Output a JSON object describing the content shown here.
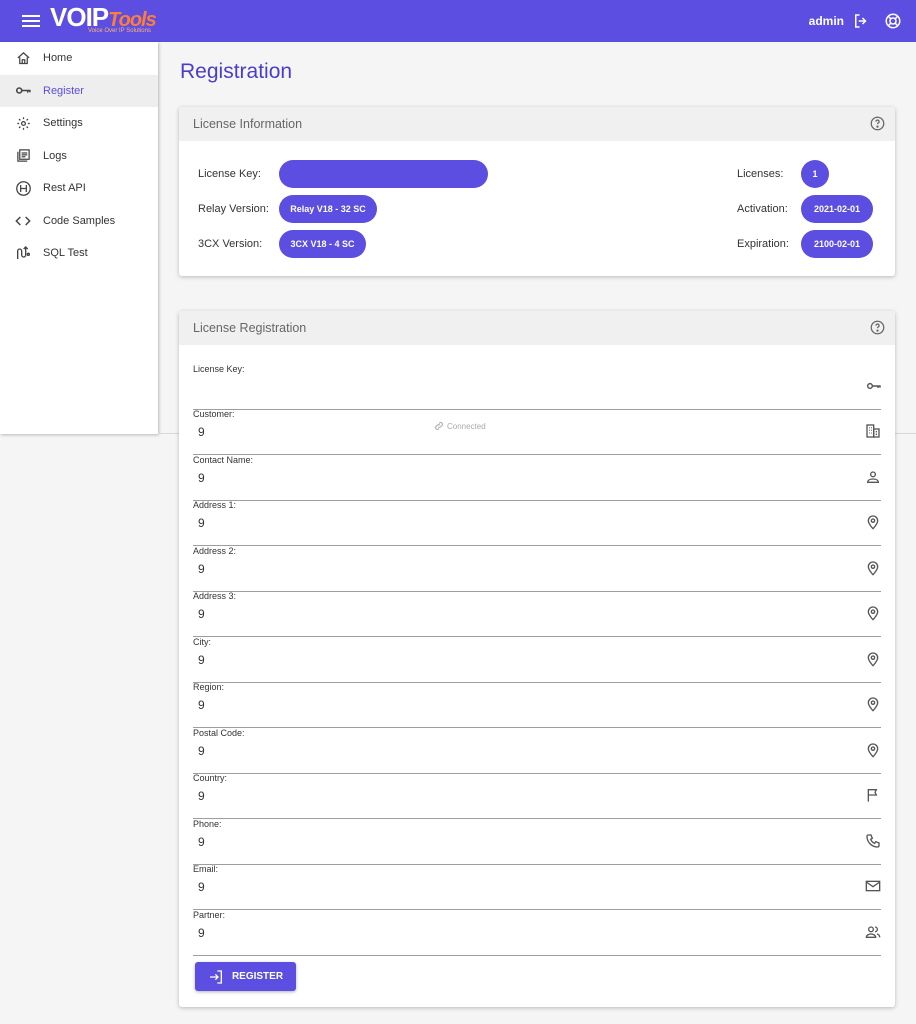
{
  "header": {
    "logo_text": "VOIPTools",
    "logo_voip": "VOIP",
    "logo_tools": "Tools",
    "logo_tagline": "Voice Over IP Solutions",
    "user": "admin"
  },
  "sidebar": {
    "items": [
      {
        "label": "Home",
        "icon": "home-icon"
      },
      {
        "label": "Register",
        "icon": "key-icon",
        "active": true
      },
      {
        "label": "Settings",
        "icon": "gear-icon"
      },
      {
        "label": "Logs",
        "icon": "logs-icon"
      },
      {
        "label": "Rest API",
        "icon": "api-icon"
      },
      {
        "label": "Code Samples",
        "icon": "code-icon"
      },
      {
        "label": "SQL Test",
        "icon": "sql-icon"
      }
    ]
  },
  "page": {
    "title": "Registration"
  },
  "license_info": {
    "title": "License Information",
    "license_key_label": "License Key:",
    "license_key_value": "",
    "relay_version_label": "Relay Version:",
    "relay_version_value": "Relay V18 - 32 SC",
    "cx_version_label": "3CX Version:",
    "cx_version_value": "3CX V18 - 4 SC",
    "licenses_label": "Licenses:",
    "licenses_value": "1",
    "activation_label": "Activation:",
    "activation_value": "2021-02-01",
    "expiration_label": "Expiration:",
    "expiration_value": "2100-02-01"
  },
  "license_registration": {
    "title": "License Registration",
    "fields": [
      {
        "label": "License Key:",
        "value": "",
        "icon": "key-icon"
      },
      {
        "label": "Customer:",
        "value": "9",
        "icon": "building-icon"
      },
      {
        "label": "Contact Name:",
        "value": "9",
        "icon": "person-icon"
      },
      {
        "label": "Address 1:",
        "value": "9",
        "icon": "location-pin-icon"
      },
      {
        "label": "Address 2:",
        "value": "9",
        "icon": "location-pin-icon"
      },
      {
        "label": "Address 3:",
        "value": "9",
        "icon": "location-pin-icon"
      },
      {
        "label": "City:",
        "value": "9",
        "icon": "location-pin-icon"
      },
      {
        "label": "Region:",
        "value": "9",
        "icon": "location-pin-icon"
      },
      {
        "label": "Postal Code:",
        "value": "9",
        "icon": "location-pin-icon"
      },
      {
        "label": "Country:",
        "value": "9",
        "icon": "flag-icon"
      },
      {
        "label": "Phone:",
        "value": "9",
        "icon": "phone-icon"
      },
      {
        "label": "Email:",
        "value": "9",
        "icon": "email-icon"
      },
      {
        "label": "Partner:",
        "value": "9",
        "icon": "people-icon"
      }
    ],
    "register_label": "REGISTER"
  },
  "status": {
    "connected": "Connected"
  },
  "colors": {
    "accent": "#5b4ee0",
    "logo_orange": "#ff7d3b"
  }
}
